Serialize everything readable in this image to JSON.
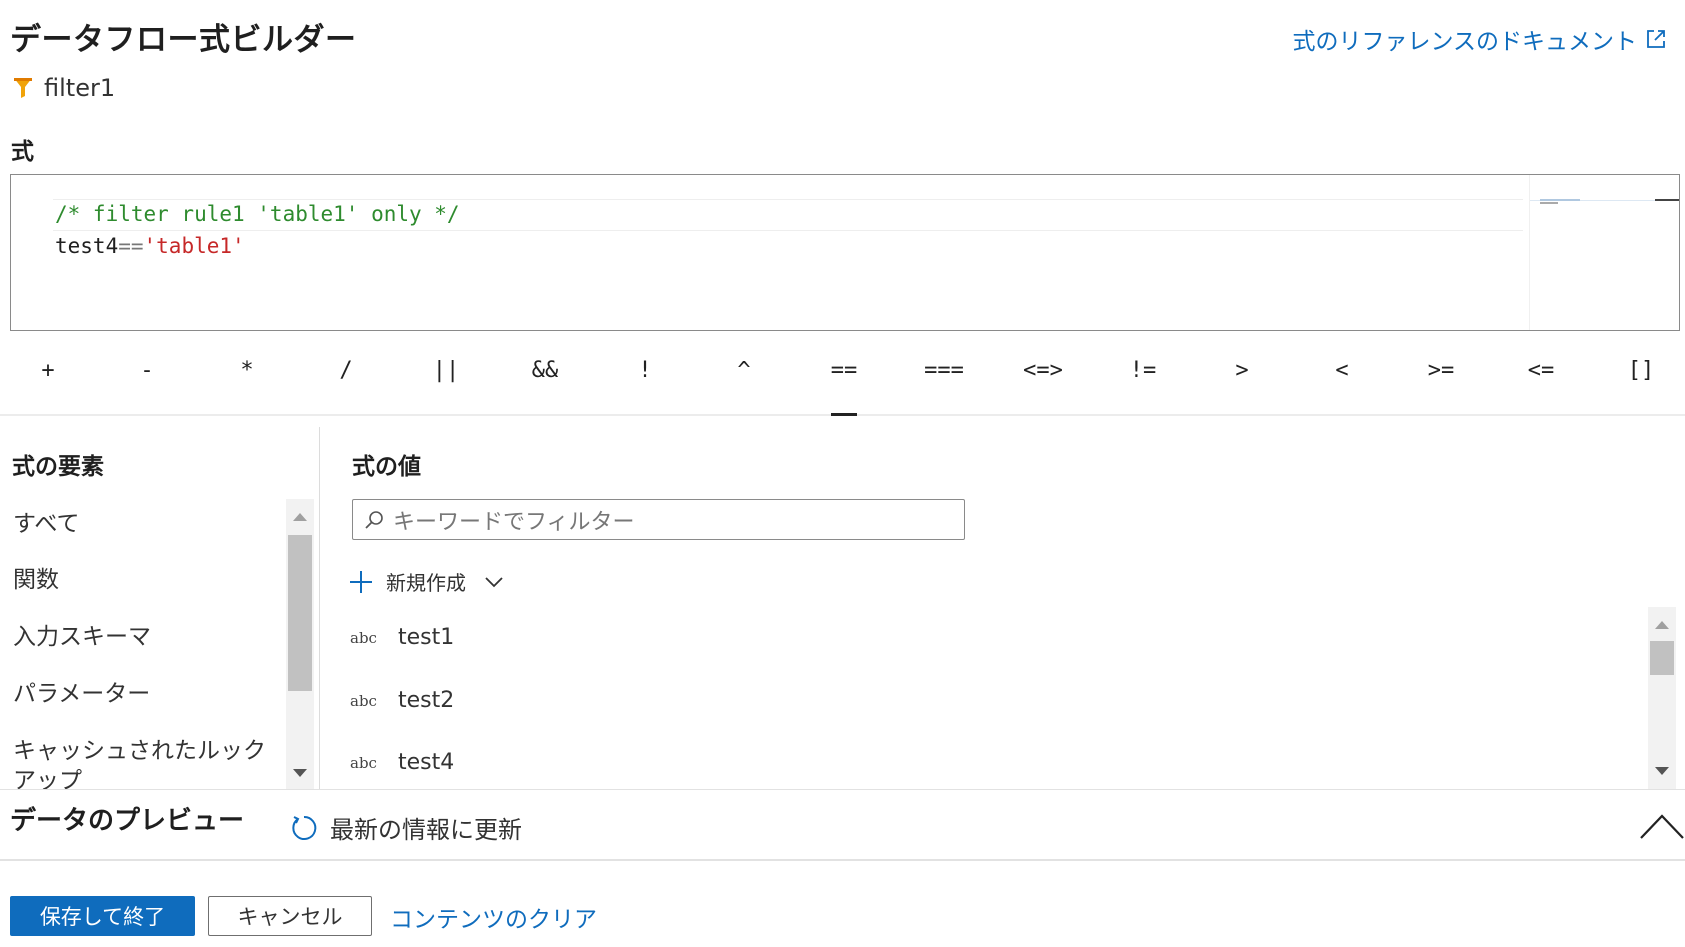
{
  "header": {
    "title": "データフロー式ビルダー",
    "doc_link": "式のリファレンスのドキュメント",
    "doc_link_icon": "external-link-icon",
    "transform_name": "filter1",
    "transform_icon": "filter-funnel-icon"
  },
  "editor": {
    "label": "式",
    "line1": "/* filter rule1 'table1' only */",
    "line2_ident": "test4",
    "line2_op": "==",
    "line2_string": "'table1'",
    "comment_color": "#2e8b2e",
    "string_color": "#c62828"
  },
  "operators": {
    "items": [
      "+",
      "-",
      "*",
      "/",
      "||",
      "&&",
      "!",
      "^",
      "==",
      "===",
      "<=>",
      "!=",
      ">",
      "<",
      ">=",
      "<=",
      "[]"
    ],
    "selected": "=="
  },
  "elements_panel": {
    "heading": "式の要素",
    "items": [
      "すべて",
      "関数",
      "入力スキーマ",
      "パラメーター",
      "キャッシュされたルックアップ"
    ]
  },
  "values_panel": {
    "heading": "式の値",
    "search_placeholder": "キーワードでフィルター",
    "new_label": "新規作成",
    "items": [
      {
        "type": "abc",
        "name": "test1"
      },
      {
        "type": "abc",
        "name": "test2"
      },
      {
        "type": "abc",
        "name": "test4"
      }
    ]
  },
  "preview": {
    "title": "データのプレビュー",
    "refresh_label": "最新の情報に更新"
  },
  "footer": {
    "save_label": "保存して終了",
    "cancel_label": "キャンセル",
    "clear_label": "コンテンツのクリア"
  },
  "colors": {
    "accent": "#0f6cbd",
    "border": "#8a8a8a"
  }
}
